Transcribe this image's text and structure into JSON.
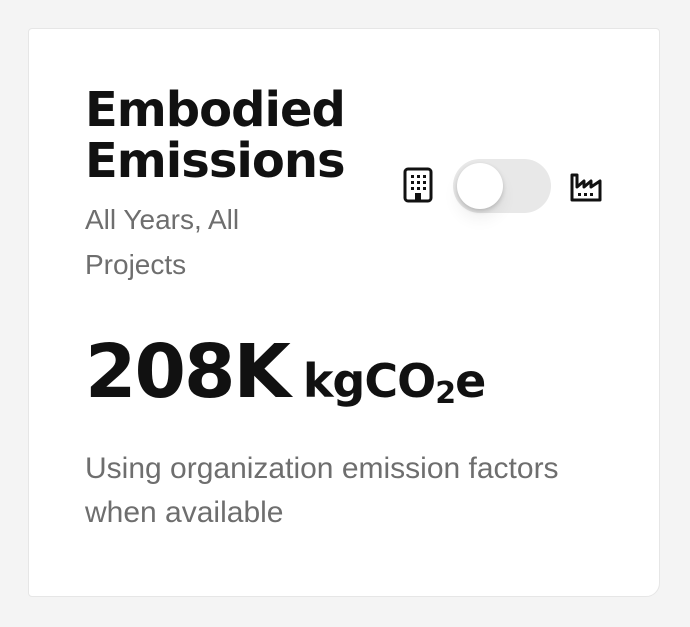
{
  "card": {
    "title": "Embodied Emissions",
    "subtitle": "All Years, All Projects",
    "toggle": {
      "left_icon": "building-icon",
      "right_icon": "factory-icon",
      "state": "left"
    },
    "metric": {
      "value": "208K",
      "unit_prefix": "kgCO",
      "unit_subscript": "2",
      "unit_suffix": "e"
    },
    "note": "Using organization emission factors when available"
  },
  "colors": {
    "background": "#f4f4f4",
    "card": "#ffffff",
    "title": "#111111",
    "muted_text": "#6e6e6e",
    "toggle_track": "#e8e8e8"
  }
}
